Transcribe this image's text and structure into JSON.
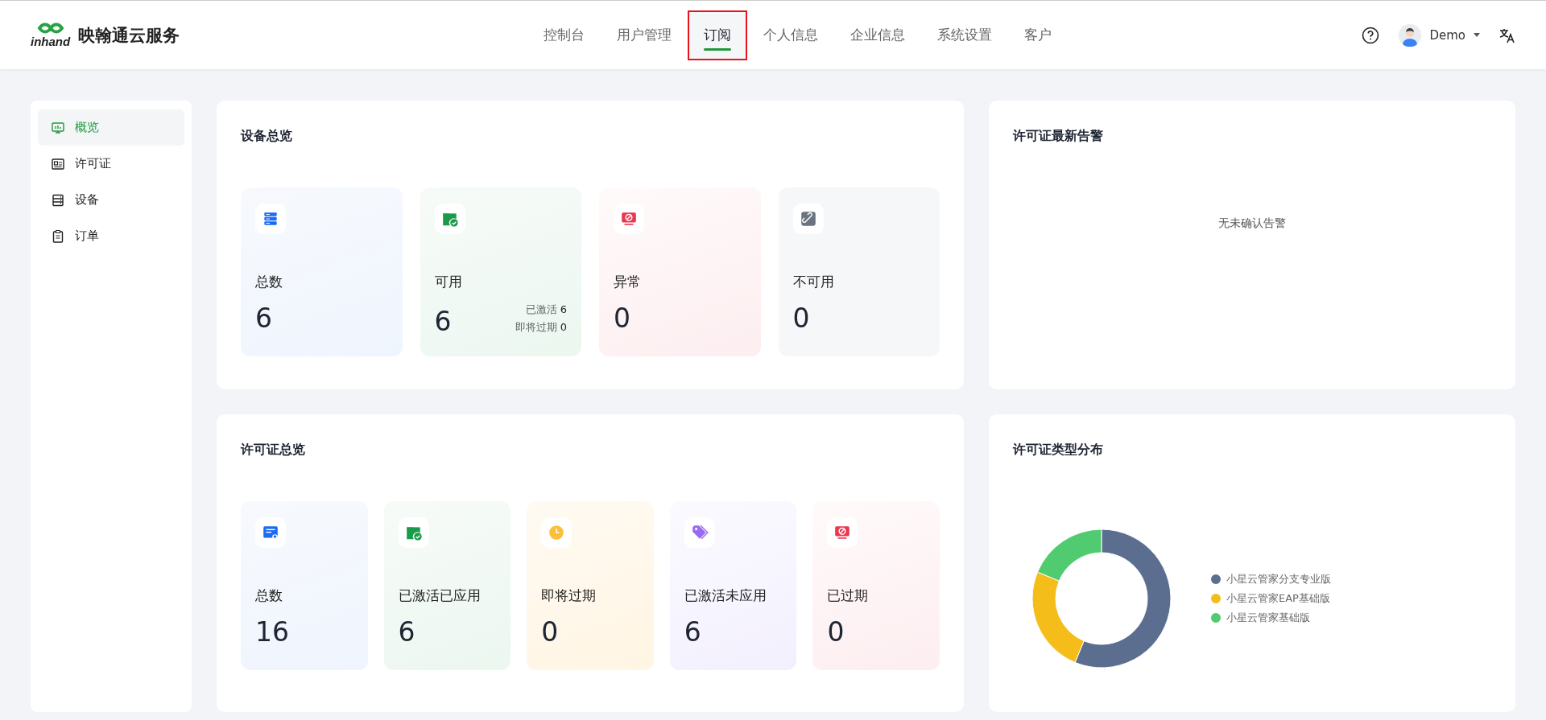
{
  "header": {
    "logo_text": "inhand",
    "brand": "映翰通云服务",
    "nav": [
      {
        "label": "控制台",
        "selected": false,
        "highlighted": false
      },
      {
        "label": "用户管理",
        "selected": false,
        "highlighted": false
      },
      {
        "label": "订阅",
        "selected": true,
        "highlighted": true
      },
      {
        "label": "个人信息",
        "selected": false,
        "highlighted": false
      },
      {
        "label": "企业信息",
        "selected": false,
        "highlighted": false
      },
      {
        "label": "系统设置",
        "selected": false,
        "highlighted": false
      },
      {
        "label": "客户",
        "selected": false,
        "highlighted": false
      }
    ],
    "user": {
      "name": "Demo"
    }
  },
  "sidebar": {
    "items": [
      {
        "kind": "overview",
        "label": "概览",
        "selected": true
      },
      {
        "kind": "license",
        "label": "许可证",
        "selected": false
      },
      {
        "kind": "device",
        "label": "设备",
        "selected": false
      },
      {
        "kind": "order",
        "label": "订单",
        "selected": false
      }
    ]
  },
  "device_overview": {
    "title": "设备总览",
    "tiles": [
      {
        "kind": "total",
        "label": "总数",
        "value": "6"
      },
      {
        "kind": "available",
        "label": "可用",
        "value": "6",
        "details": [
          {
            "label": "已激活",
            "value": "6"
          },
          {
            "label": "即将过期",
            "value": "0"
          }
        ]
      },
      {
        "kind": "abnormal",
        "label": "异常",
        "value": "0"
      },
      {
        "kind": "unavailable",
        "label": "不可用",
        "value": "0"
      }
    ]
  },
  "license_alerts": {
    "title": "许可证最新告警",
    "empty_text": "无未确认告警"
  },
  "license_overview": {
    "title": "许可证总览",
    "tiles": [
      {
        "kind": "license",
        "label": "总数",
        "value": "16"
      },
      {
        "kind": "available",
        "label": "已激活已应用",
        "value": "6"
      },
      {
        "kind": "expiring",
        "label": "即将过期",
        "value": "0"
      },
      {
        "kind": "unapplied",
        "label": "已激活未应用",
        "value": "6"
      },
      {
        "kind": "expired",
        "label": "已过期",
        "value": "0"
      }
    ]
  },
  "license_types": {
    "title": "许可证类型分布",
    "legend": [
      {
        "label": "小星云管家分支专业版",
        "color": "#5b6e8f"
      },
      {
        "label": "小星云管家EAP基础版",
        "color": "#f5bd19"
      },
      {
        "label": "小星云管家基础版",
        "color": "#51cb6f"
      }
    ]
  }
}
